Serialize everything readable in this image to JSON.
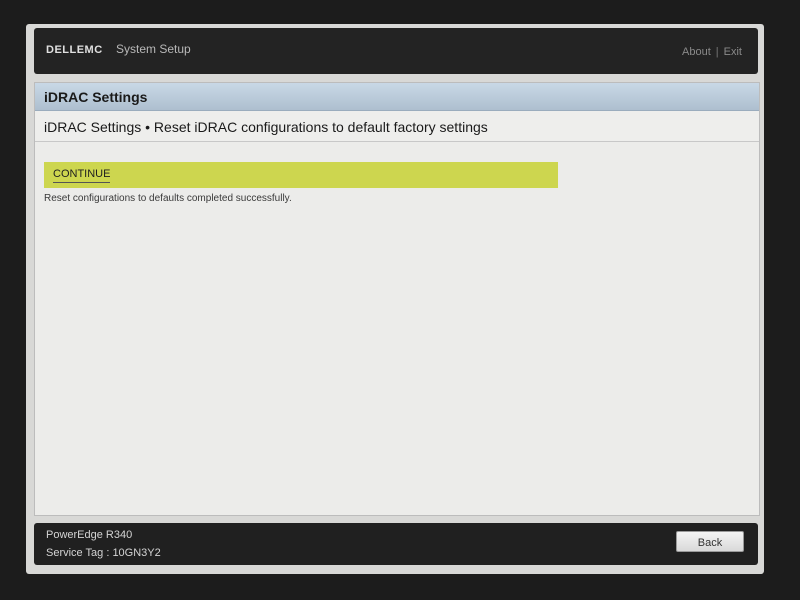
{
  "header": {
    "logo": "DELLEMC",
    "title": "System Setup",
    "links": [
      "About",
      "Exit"
    ]
  },
  "page": {
    "header_title": "iDRAC Settings",
    "subtitle": "iDRAC Settings • Reset iDRAC configurations to default factory settings",
    "continue_label": "CONTINUE",
    "message": "Reset configurations to defaults completed successfully."
  },
  "footer": {
    "model": "PowerEdge R340",
    "service_tag": "Service Tag : 10GN3Y2",
    "back_label": "Back"
  },
  "colors": {
    "header_gradient_top": "#c9d8e6",
    "highlight": "#cdd64f",
    "bar_dark": "#232323"
  }
}
